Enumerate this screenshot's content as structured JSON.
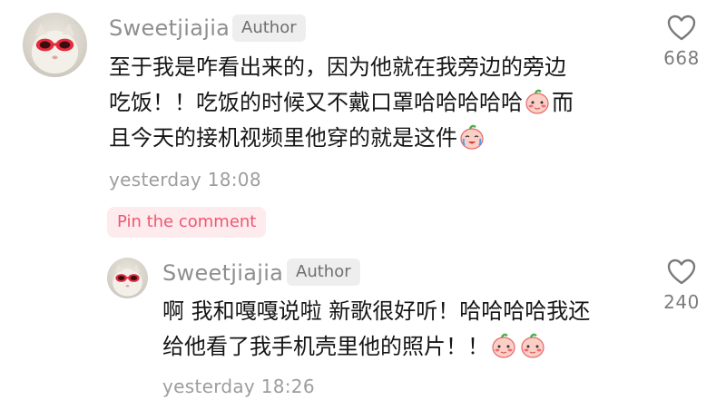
{
  "comments": [
    {
      "username": "Sweetjiajia",
      "badge": "Author",
      "lines": [
        "至于我是咋看出来的，因为他就在我旁边的旁边",
        "吃饭！！吃饭的时候又不戴口罩哈哈哈哈哈",
        "而",
        "且今天的接机视频里他穿的就是这件"
      ],
      "timestamp": "yesterday 18:08",
      "likes": "668",
      "emoji_names": [
        "blushing-peach-emoji",
        "crying-laughing-peach-emoji"
      ]
    }
  ],
  "pin_label": "Pin the comment",
  "reply": {
    "username": "Sweetjiajia",
    "badge": "Author",
    "lines": [
      "啊 我和嘎嘎说啦 新歌很好听！哈哈哈哈我还",
      "给他看了我手机壳里他的照片！！"
    ],
    "timestamp": "yesterday 18:26",
    "likes": "240",
    "emoji_names": [
      "blushing-peach-emoji",
      "blushing-peach-emoji"
    ]
  },
  "colors": {
    "username": "#8f8f8f",
    "text": "#161616",
    "muted": "#9d9d9d",
    "badge_bg": "#eeeeee",
    "pin_bg": "#fdebee",
    "pin_text": "#f0576f"
  },
  "icons": [
    "heart-outline-icon",
    "avatar-cat-with-red-sunglasses"
  ]
}
